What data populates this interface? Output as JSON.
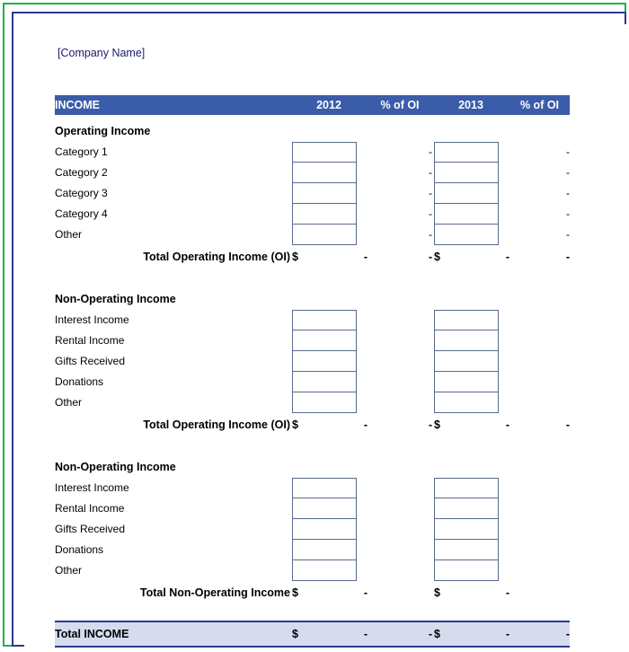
{
  "document": {
    "company_name": "[Company Name]"
  },
  "table": {
    "header": {
      "title": "INCOME",
      "year1": "2012",
      "pct1": "% of OI",
      "year2": "2013",
      "pct2": "% of OI"
    },
    "sections": [
      {
        "title": "Operating Income",
        "rows": [
          {
            "label": "Category 1",
            "pct1": "-",
            "pct2": "-"
          },
          {
            "label": "Category 2",
            "pct1": "-",
            "pct2": "-"
          },
          {
            "label": "Category 3",
            "pct1": "-",
            "pct2": "-"
          },
          {
            "label": "Category 4",
            "pct1": "-",
            "pct2": "-"
          },
          {
            "label": "Other",
            "pct1": "-",
            "pct2": "-"
          }
        ],
        "total": {
          "label": "Total Operating Income (OI)",
          "dollar1": "$",
          "amount1": "-",
          "pct1": "-",
          "dollar2": "$",
          "amount2": "-",
          "pct2": "-"
        }
      },
      {
        "title": "Non-Operating Income",
        "rows": [
          {
            "label": "Interest Income",
            "pct1": "",
            "pct2": ""
          },
          {
            "label": "Rental Income",
            "pct1": "",
            "pct2": ""
          },
          {
            "label": "Gifts Received",
            "pct1": "",
            "pct2": ""
          },
          {
            "label": "Donations",
            "pct1": "",
            "pct2": ""
          },
          {
            "label": "Other",
            "pct1": "",
            "pct2": ""
          }
        ],
        "total": {
          "label": "Total Operating Income (OI)",
          "dollar1": "$",
          "amount1": "-",
          "pct1": "-",
          "dollar2": "$",
          "amount2": "-",
          "pct2": "-"
        }
      },
      {
        "title": "Non-Operating Income",
        "rows": [
          {
            "label": "Interest Income",
            "pct1": "",
            "pct2": ""
          },
          {
            "label": "Rental Income",
            "pct1": "",
            "pct2": ""
          },
          {
            "label": "Gifts Received",
            "pct1": "",
            "pct2": ""
          },
          {
            "label": "Donations",
            "pct1": "",
            "pct2": ""
          },
          {
            "label": "Other",
            "pct1": "",
            "pct2": ""
          }
        ],
        "total": {
          "label": "Total Non-Operating Income",
          "dollar1": "$",
          "amount1": "-",
          "pct1": "",
          "dollar2": "$",
          "amount2": "-",
          "pct2": ""
        }
      }
    ],
    "grand_total": {
      "label": "Total INCOME",
      "dollar1": "$",
      "amount1": "-",
      "pct1": "-",
      "dollar2": "$",
      "amount2": "-",
      "pct2": "-"
    }
  },
  "colors": {
    "header_bar": "#3b5ca8",
    "grand_bar": "#d6dcee",
    "border_blue": "#2b3990",
    "border_green": "#22b14c"
  }
}
